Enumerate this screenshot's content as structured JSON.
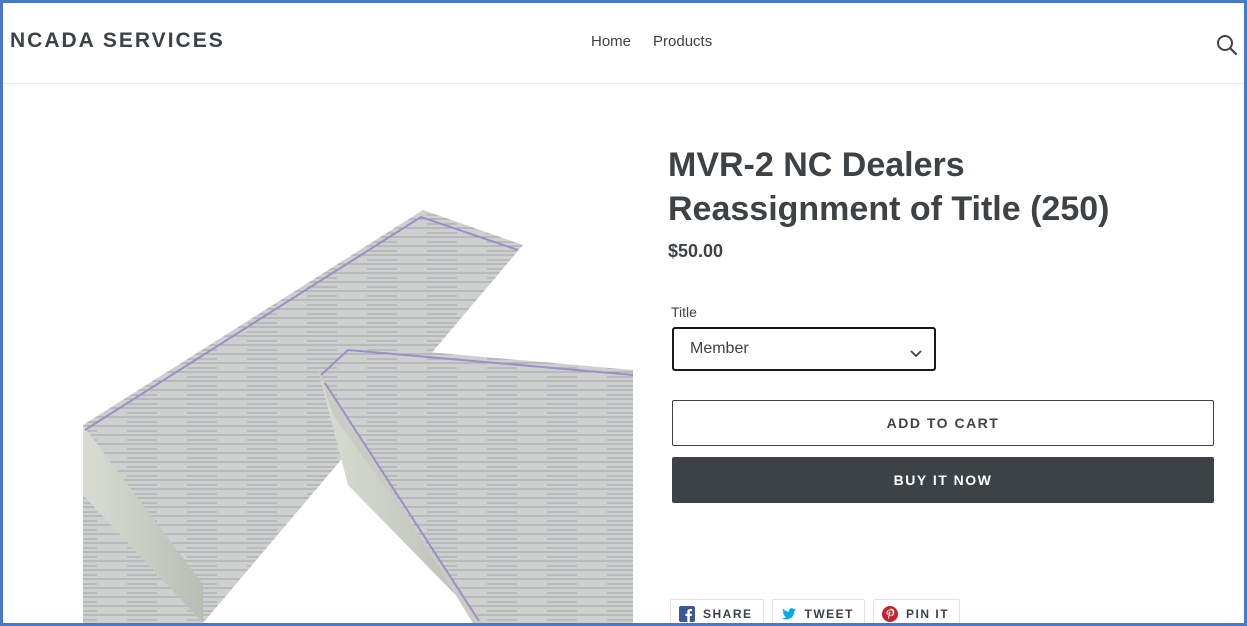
{
  "header": {
    "logo": "NCADA SERVICES",
    "nav": [
      "Home",
      "Products"
    ],
    "search_icon": "search-icon"
  },
  "product": {
    "image_icon": "product-photo",
    "title": "MVR-2 NC Dealers Reassignment of Title (250)",
    "price": "$50.00",
    "option_label": "Title",
    "option_value": "Member",
    "add_to_cart": "ADD TO CART",
    "buy_now": "BUY IT NOW"
  },
  "social": {
    "share": "SHARE",
    "tweet": "TWEET",
    "pin": "PIN IT"
  },
  "colors": {
    "frame_border": "#4a78c9",
    "text": "#3d4246",
    "buy_button": "#3d4246",
    "facebook": "#3b5998",
    "twitter": "#00aced",
    "pinterest": "#cb2027"
  }
}
